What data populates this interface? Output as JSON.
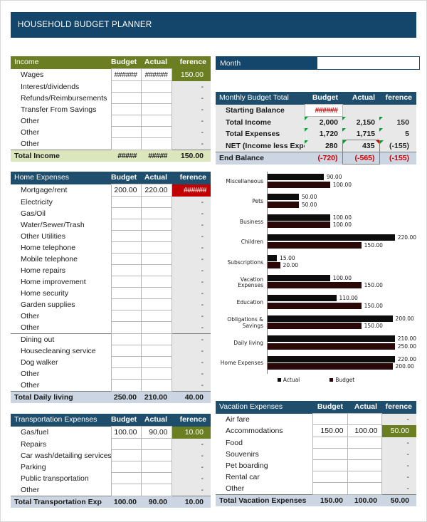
{
  "title": "HOUSEHOLD BUDGET PLANNER",
  "colors": {
    "navy": "#14466b",
    "header_navy": "#1f4e6d",
    "olive": "#6b7f22",
    "olive_total": "#dbe6bd",
    "blue_total": "#ccd6e3",
    "red": "#c00000",
    "negative_text": "#d00000",
    "diff_cell": "#e8e8e8"
  },
  "month": {
    "label": "Month",
    "value": "",
    "placeholder": ""
  },
  "income": {
    "header": {
      "label": "Income",
      "budget": "Budget",
      "actual": "Actual",
      "difference": "ference"
    },
    "rows": [
      {
        "label": "Wages",
        "budget": "######",
        "actual": "######",
        "difference": "150.00",
        "diff_style": "green"
      },
      {
        "label": "Interest/dividends",
        "budget": "",
        "actual": "",
        "difference": "-",
        "diff_style": ""
      },
      {
        "label": "Refunds/Reimbursements",
        "budget": "",
        "actual": "",
        "difference": "-",
        "diff_style": ""
      },
      {
        "label": "Transfer From Savings",
        "budget": "",
        "actual": "",
        "difference": "-",
        "diff_style": ""
      },
      {
        "label": "Other",
        "budget": "",
        "actual": "",
        "difference": "-",
        "diff_style": ""
      },
      {
        "label": "Other",
        "budget": "",
        "actual": "",
        "difference": "-",
        "diff_style": ""
      },
      {
        "label": "Other",
        "budget": "",
        "actual": "",
        "difference": "-",
        "diff_style": ""
      }
    ],
    "total": {
      "label": "Total Income",
      "budget": "#####",
      "actual": "#####",
      "difference": "150.00"
    }
  },
  "monthly_budget_total": {
    "header": {
      "label": "Monthly Budget Total",
      "budget": "Budget",
      "actual": "Actual",
      "difference": "ference"
    },
    "rows": [
      {
        "label": "Starting Balance",
        "budget": "######",
        "actual": "",
        "difference": ""
      },
      {
        "label": "Total Income",
        "budget": "2,000",
        "actual": "2,150",
        "difference": "150"
      },
      {
        "label": "Total Expenses",
        "budget": "1,720",
        "actual": "1,715",
        "difference": "5"
      },
      {
        "label": "NET (Income less Expe",
        "budget": "280",
        "actual": "435",
        "difference": "(-155)"
      }
    ],
    "end_balance": {
      "label": "End Balance",
      "budget": "(-720)",
      "actual": "(-565)",
      "difference": "(-155)"
    }
  },
  "home_expenses": {
    "header": {
      "label": "Home Expenses",
      "budget": "Budget",
      "actual": "Actual",
      "difference": "ference"
    },
    "rows": [
      {
        "label": "Mortgage/rent",
        "budget": "200.00",
        "actual": "220.00",
        "difference": "######",
        "diff_style": "red"
      },
      {
        "label": "Electricity",
        "budget": "",
        "actual": "",
        "difference": "-",
        "diff_style": ""
      },
      {
        "label": "Gas/Oil",
        "budget": "",
        "actual": "",
        "difference": "-",
        "diff_style": ""
      },
      {
        "label": "Water/Sewer/Trash",
        "budget": "",
        "actual": "",
        "difference": "-",
        "diff_style": ""
      },
      {
        "label": "Other Utilities",
        "budget": "",
        "actual": "",
        "difference": "-",
        "diff_style": ""
      },
      {
        "label": "Home telephone",
        "budget": "",
        "actual": "",
        "difference": "-",
        "diff_style": ""
      },
      {
        "label": "Mobile telephone",
        "budget": "",
        "actual": "",
        "difference": "-",
        "diff_style": ""
      },
      {
        "label": "Home repairs",
        "budget": "",
        "actual": "",
        "difference": "-",
        "diff_style": ""
      },
      {
        "label": "Home improvement",
        "budget": "",
        "actual": "",
        "difference": "-",
        "diff_style": ""
      },
      {
        "label": "Home security",
        "budget": "",
        "actual": "",
        "difference": "-",
        "diff_style": ""
      },
      {
        "label": "Garden supplies",
        "budget": "",
        "actual": "",
        "difference": "-",
        "diff_style": ""
      },
      {
        "label": "Other",
        "budget": "",
        "actual": "",
        "difference": "-",
        "diff_style": ""
      },
      {
        "label": "Other",
        "budget": "",
        "actual": "",
        "difference": "-",
        "diff_style": ""
      }
    ],
    "daily_living_rows": [
      {
        "label": "Dining out",
        "budget": "",
        "actual": "",
        "difference": "-",
        "diff_style": ""
      },
      {
        "label": "Housecleaning service",
        "budget": "",
        "actual": "",
        "difference": "-",
        "diff_style": ""
      },
      {
        "label": "Dog walker",
        "budget": "",
        "actual": "",
        "difference": "-",
        "diff_style": ""
      },
      {
        "label": "Other",
        "budget": "",
        "actual": "",
        "difference": "-",
        "diff_style": ""
      },
      {
        "label": "Other",
        "budget": "",
        "actual": "",
        "difference": "-",
        "diff_style": ""
      }
    ],
    "total": {
      "label": "Total Daily living",
      "budget": "250.00",
      "actual": "210.00",
      "difference": "40.00"
    }
  },
  "transportation": {
    "header": {
      "label": "Transportation Expenses",
      "budget": "Budget",
      "actual": "Actual",
      "difference": "ference"
    },
    "rows": [
      {
        "label": "Gas/fuel",
        "budget": "100.00",
        "actual": "90.00",
        "difference": "10.00",
        "diff_style": "green"
      },
      {
        "label": "Repairs",
        "budget": "",
        "actual": "",
        "difference": "-",
        "diff_style": ""
      },
      {
        "label": "Car wash/detailing services",
        "budget": "",
        "actual": "",
        "difference": "-",
        "diff_style": ""
      },
      {
        "label": "Parking",
        "budget": "",
        "actual": "",
        "difference": "-",
        "diff_style": ""
      },
      {
        "label": "Public transportation",
        "budget": "",
        "actual": "",
        "difference": "-",
        "diff_style": ""
      },
      {
        "label": "Other",
        "budget": "",
        "actual": "",
        "difference": "-",
        "diff_style": ""
      }
    ],
    "total": {
      "label": "Total Transportation Exp",
      "budget": "100.00",
      "actual": "90.00",
      "difference": "10.00"
    }
  },
  "vacation": {
    "header": {
      "label": "Vacation Expenses",
      "budget": "Budget",
      "actual": "Actual",
      "difference": "ference"
    },
    "rows": [
      {
        "label": "Air fare",
        "budget": "",
        "actual": "",
        "difference": "-",
        "diff_style": ""
      },
      {
        "label": "Accommodations",
        "budget": "150.00",
        "actual": "100.00",
        "difference": "50.00",
        "diff_style": "green"
      },
      {
        "label": "Food",
        "budget": "",
        "actual": "",
        "difference": "-",
        "diff_style": ""
      },
      {
        "label": "Souvenirs",
        "budget": "",
        "actual": "",
        "difference": "-",
        "diff_style": ""
      },
      {
        "label": "Pet boarding",
        "budget": "",
        "actual": "",
        "difference": "-",
        "diff_style": ""
      },
      {
        "label": "Rental car",
        "budget": "",
        "actual": "",
        "difference": "-",
        "diff_style": ""
      },
      {
        "label": "Other",
        "budget": "",
        "actual": "",
        "difference": "-",
        "diff_style": ""
      }
    ],
    "total": {
      "label": "Total Vacation Expenses",
      "budget": "150.00",
      "actual": "100.00",
      "difference": "50.00"
    }
  },
  "chart_data": {
    "type": "bar",
    "orientation": "horizontal",
    "title": "",
    "xlabel": "",
    "ylabel": "",
    "grid": false,
    "legend_position": "bottom",
    "xlim": [
      0,
      250
    ],
    "categories": [
      "Miscellaneous",
      "Pets",
      "Business",
      "Children",
      "Subscriptions",
      "Vacation Expenses",
      "Education",
      "Obligations & Savings",
      "Daily living",
      "Home Expenses"
    ],
    "series": [
      {
        "name": "Actual",
        "color": "#0d0d0d",
        "values": [
          90,
          50,
          100,
          220,
          15,
          100,
          110,
          200,
          210,
          220
        ],
        "labels": [
          "90.00",
          "50.00",
          "100.00",
          "220.00",
          "15.00",
          "100.00",
          "110.00",
          "200.00",
          "210.00",
          "220.00"
        ]
      },
      {
        "name": "Budget",
        "color": "#2a0808",
        "values": [
          100,
          50,
          100,
          150,
          20,
          150,
          150,
          150,
          250,
          200
        ],
        "labels": [
          "100.00",
          "50.00",
          "100.00",
          "150.00",
          "20.00",
          "150.00",
          "150.00",
          "150.00",
          "250.00",
          "200.00"
        ]
      }
    ]
  }
}
